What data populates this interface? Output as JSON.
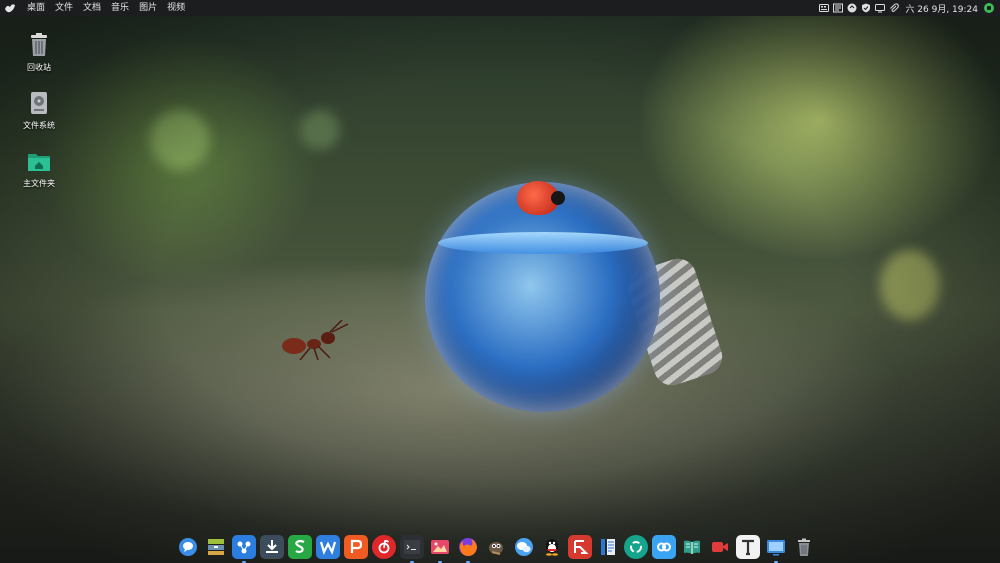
{
  "topbar": {
    "menu": [
      "桌面",
      "文件",
      "文档",
      "音乐",
      "图片",
      "视频"
    ],
    "clock": "六 26 9月, 19:24"
  },
  "desktop": {
    "icons": [
      "回收站",
      "文件系统",
      "主文件夹"
    ]
  },
  "dock": {
    "apps": [
      {
        "icon": "chat-bubble-icon",
        "color": "#3b8ee8"
      },
      {
        "icon": "archive-manager-icon",
        "color": "#9fbf3b"
      },
      {
        "icon": "network-app-icon",
        "color": "#2b7de0"
      },
      {
        "icon": "download-manager-icon",
        "color": "#3c4c5c"
      },
      {
        "icon": "wps-spreadsheet-icon",
        "color": "#27a844"
      },
      {
        "icon": "wps-writer-icon",
        "color": "#2f7fe0"
      },
      {
        "icon": "wps-presentation-icon",
        "color": "#f05a23"
      },
      {
        "icon": "netease-music-icon",
        "color": "#e0272a"
      },
      {
        "icon": "terminal-icon",
        "color": "#2c2f33"
      },
      {
        "icon": "image-viewer-icon",
        "color": "#e8476a"
      },
      {
        "icon": "firefox-icon",
        "color": "#ff7a1a"
      },
      {
        "icon": "gimp-icon",
        "color": "#6d5a46"
      },
      {
        "icon": "wechat-icon",
        "color": "#4aa3f0"
      },
      {
        "icon": "qq-penguin-icon",
        "color": "#111111"
      },
      {
        "icon": "filezilla-icon",
        "color": "#d63a2f"
      },
      {
        "icon": "document-reader-icon",
        "color": "#2a77d6"
      },
      {
        "icon": "recycle-app-icon",
        "color": "#16a58c"
      },
      {
        "icon": "baidu-netdisk-icon",
        "color": "#3aa3f2"
      },
      {
        "icon": "ebook-reader-icon",
        "color": "#2f9d8a"
      },
      {
        "icon": "screen-recorder-icon",
        "color": "#e23b3b"
      },
      {
        "icon": "font-viewer-icon",
        "color": "#f2f2f2"
      },
      {
        "icon": "monitor-icon",
        "color": "#3a8ce0"
      },
      {
        "icon": "trash-icon",
        "color": "#8a8f95"
      }
    ]
  }
}
